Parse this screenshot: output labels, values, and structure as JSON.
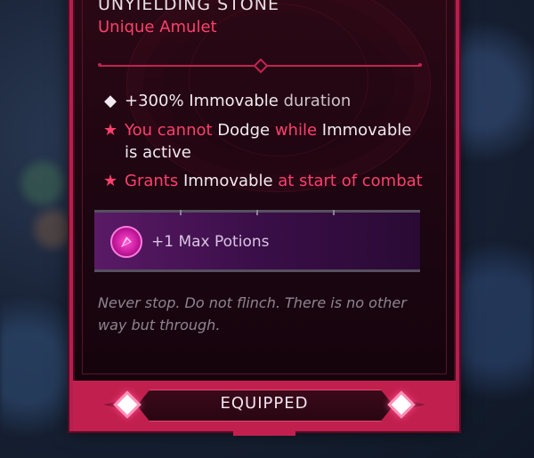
{
  "item": {
    "name": "UNYIELDING STONE",
    "type": "Unique Amulet"
  },
  "affixes": [
    {
      "bullet": "◆",
      "segments": [
        {
          "text": "+300% Immovable ",
          "style": "white"
        },
        {
          "text": "duration",
          "style": "muted"
        }
      ]
    },
    {
      "bullet": "★",
      "segments": [
        {
          "text": "You cannot ",
          "style": "pink"
        },
        {
          "text": "Dodge ",
          "style": "white"
        },
        {
          "text": "while ",
          "style": "pink"
        },
        {
          "text": "Immovable is active",
          "style": "white"
        }
      ]
    },
    {
      "bullet": "★",
      "segments": [
        {
          "text": "Grants ",
          "style": "pink"
        },
        {
          "text": "Immovable ",
          "style": "white"
        },
        {
          "text": "at start of combat",
          "style": "pink"
        }
      ]
    }
  ],
  "bonus": {
    "label": "+1 Max Potions",
    "icon": "potion-icon"
  },
  "flavor_text": "Never stop. Do not flinch. There is no other way but through.",
  "footer": {
    "status_label": "EQUIPPED"
  },
  "colors": {
    "frame": "#b51f4f",
    "accent_pink": "#ff3f6d",
    "bonus_purple": "#5a1a66"
  }
}
